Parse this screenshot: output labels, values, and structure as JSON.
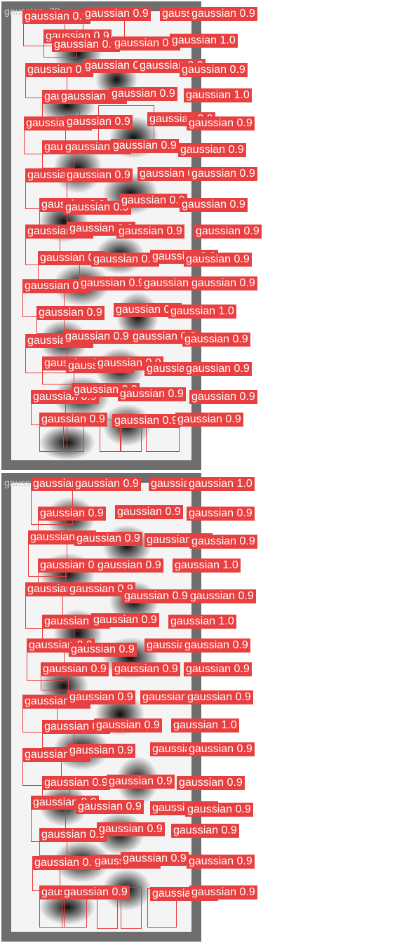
{
  "panels": [
    {
      "title": "gaussian_78"
    },
    {
      "title": "gaussian_79"
    }
  ],
  "detection": {
    "label": "gaussian",
    "score": "0.9",
    "score_alt": "1.0"
  },
  "colors": {
    "box": "#e83a3a",
    "tag_bg": "#e84040",
    "frame": "#6e6e6e",
    "canvas": "#f4f4f4"
  }
}
